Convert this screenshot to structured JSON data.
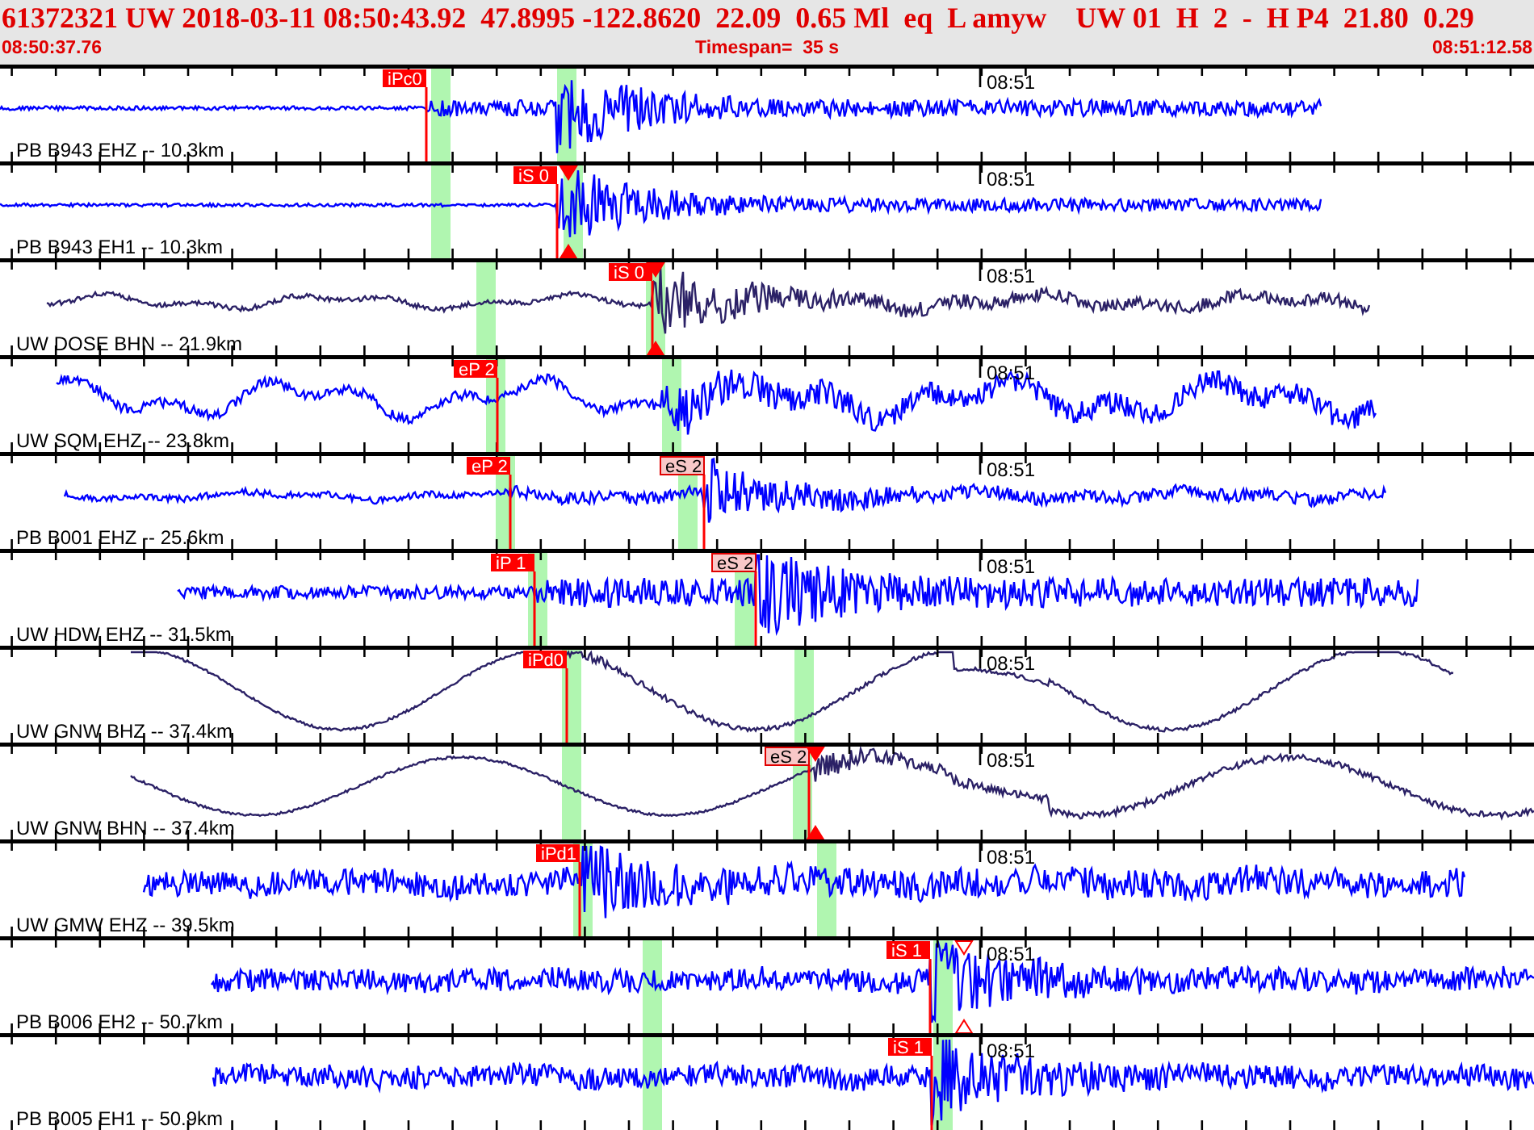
{
  "header": {
    "event_line": "61372321 UW 2018-03-11 08:50:43.92  47.8995 -122.8620  22.09  0.65 Ml  eq  L amyw    UW 01  H  2  -  H P4  21.80  0.29",
    "start_time": "08:50:37.76",
    "timespan": "Timespan=  35 s",
    "end_time": "08:51:12.58"
  },
  "traces": [
    {
      "label": "PB B943 EHZ -- 10.3km",
      "time_label": "08:51",
      "picks": [
        {
          "label": "iPc0",
          "kind": "solid"
        }
      ]
    },
    {
      "label": "PB B943 EH1 -- 10.3km",
      "time_label": "08:51",
      "picks": [
        {
          "label": "iS 0",
          "kind": "solid"
        }
      ]
    },
    {
      "label": "UW DOSE BHN -- 21.9km",
      "time_label": "08:51",
      "picks": [
        {
          "label": "iS 0",
          "kind": "solid"
        }
      ]
    },
    {
      "label": "UW SQM EHZ -- 23.8km",
      "time_label": "08:51",
      "picks": [
        {
          "label": "eP 2",
          "kind": "solid"
        }
      ]
    },
    {
      "label": "PB B001 EHZ -- 25.6km",
      "time_label": "08:51",
      "picks": [
        {
          "label": "eP 2",
          "kind": "solid"
        },
        {
          "label": "eS 2",
          "kind": "pale"
        }
      ]
    },
    {
      "label": "UW HDW EHZ -- 31.5km",
      "time_label": "08:51",
      "picks": [
        {
          "label": "iP 1",
          "kind": "solid"
        },
        {
          "label": "eS 2",
          "kind": "pale"
        }
      ]
    },
    {
      "label": "UW GNW BHZ -- 37.4km",
      "time_label": "08:51",
      "picks": [
        {
          "label": "iPd0",
          "kind": "solid"
        }
      ]
    },
    {
      "label": "UW GNW BHN -- 37.4km",
      "time_label": "08:51",
      "picks": [
        {
          "label": "eS 2",
          "kind": "pale"
        }
      ]
    },
    {
      "label": "UW GMW EHZ -- 39.5km",
      "time_label": "08:51",
      "picks": [
        {
          "label": "iPd1",
          "kind": "solid"
        }
      ]
    },
    {
      "label": "PB B006 EH2 -- 50.7km",
      "time_label": "08:51",
      "picks": [
        {
          "label": "iS 1",
          "kind": "solid"
        }
      ]
    },
    {
      "label": "PB B005 EH1 -- 50.9km",
      "time_label": "08:51",
      "picks": [
        {
          "label": "iS 1",
          "kind": "solid"
        }
      ]
    }
  ]
}
